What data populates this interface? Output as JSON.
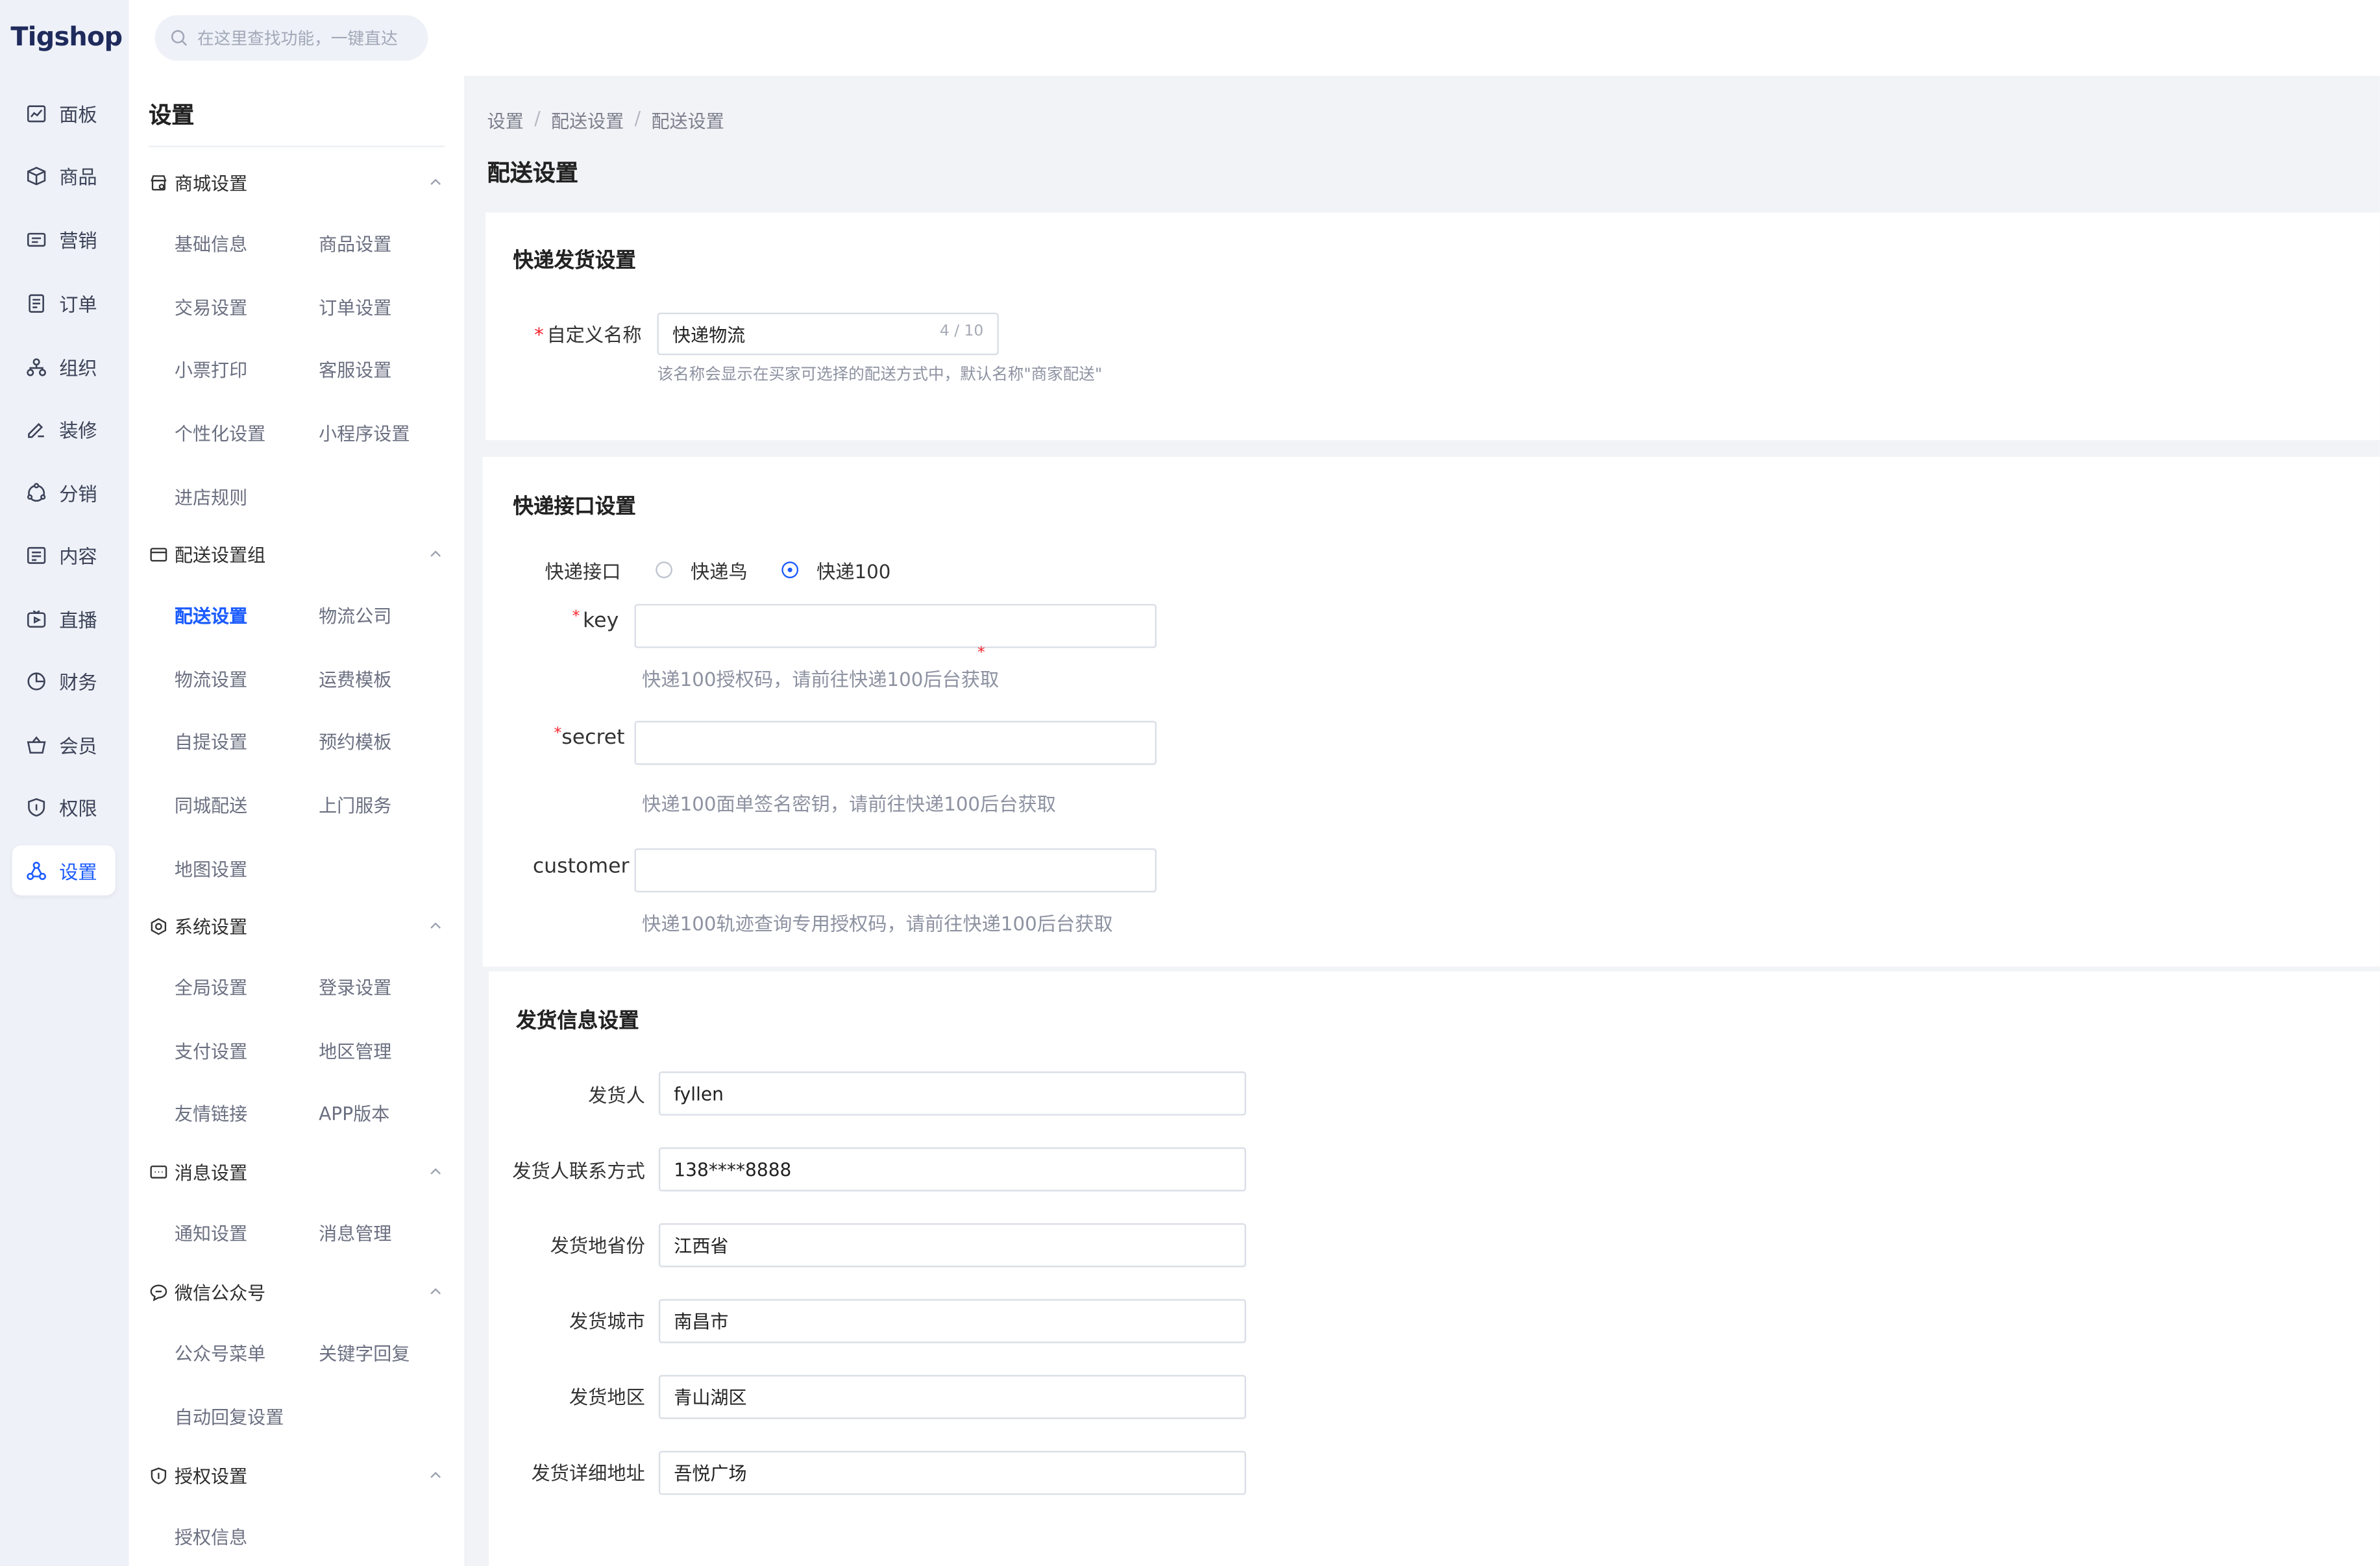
{
  "brand": {
    "logo": "Tigshop",
    "accent": "#1c5cff",
    "rail_bg": "#eef1f7"
  },
  "search": {
    "placeholder": "在这里查找功能，一键直达"
  },
  "rail": {
    "items": [
      {
        "label": "面板",
        "icon": "chart-icon"
      },
      {
        "label": "商品",
        "icon": "box-icon"
      },
      {
        "label": "营销",
        "icon": "ticket-icon"
      },
      {
        "label": "订单",
        "icon": "order-icon"
      },
      {
        "label": "组织",
        "icon": "org-icon"
      },
      {
        "label": "装修",
        "icon": "paint-icon"
      },
      {
        "label": "分销",
        "icon": "share-icon"
      },
      {
        "label": "内容",
        "icon": "content-icon"
      },
      {
        "label": "直播",
        "icon": "live-icon"
      },
      {
        "label": "财务",
        "icon": "pie-icon"
      },
      {
        "label": "会员",
        "icon": "basket-icon"
      },
      {
        "label": "权限",
        "icon": "shield-icon"
      },
      {
        "label": "设置",
        "icon": "settings-icon"
      }
    ]
  },
  "subnav": {
    "title": "设置",
    "groups": [
      {
        "label": "商城设置",
        "items": [
          "基础信息",
          "商品设置",
          "交易设置",
          "订单设置",
          "小票打印",
          "客服设置",
          "个性化设置",
          "小程序设置",
          "进店规则"
        ]
      },
      {
        "label": "配送设置组",
        "items": [
          "配送设置",
          "物流公司",
          "物流设置",
          "运费模板",
          "自提设置",
          "预约模板",
          "同城配送",
          "上门服务",
          "地图设置"
        ]
      },
      {
        "label": "系统设置",
        "items": [
          "全局设置",
          "登录设置",
          "支付设置",
          "地区管理",
          "友情链接",
          "APP版本"
        ]
      },
      {
        "label": "消息设置",
        "items": [
          "通知设置",
          "消息管理"
        ]
      },
      {
        "label": "微信公众号",
        "items": [
          "公众号菜单",
          "关键字回复",
          "自动回复设置"
        ]
      },
      {
        "label": "授权设置",
        "items": [
          "授权信息"
        ]
      }
    ]
  },
  "breadcrumb": [
    "设置",
    "配送设置",
    "配送设置"
  ],
  "page_title": "配送设置",
  "express_card": {
    "title": "快递发货设置",
    "name_label": "自定义名称",
    "name_value": "快递物流",
    "name_count": "4 / 10",
    "name_hint": "该名称会显示在买家可选择的配送方式中，默认名称\"商家配送\""
  },
  "api_card": {
    "title": "快递接口设置",
    "interface_label": "快递接口",
    "options": [
      "快递鸟",
      "快递100"
    ],
    "selected": "快递100",
    "key_label": "key",
    "key_hint": "快递100授权码，请前往快递100后台获取",
    "secret_label": "secret",
    "secret_hint": "快递100面单签名密钥，请前往快递100后台获取",
    "customer_label": "customer",
    "customer_hint": "快递100轨迹查询专用授权码，请前往快递100后台获取"
  },
  "ship_card": {
    "title": "发货信息设置",
    "fields": [
      {
        "label": "发货人",
        "value": "fyllen"
      },
      {
        "label": "发货人联系方式",
        "value": "138****8888"
      },
      {
        "label": "发货地省份",
        "value": "江西省"
      },
      {
        "label": "发货城市",
        "value": "南昌市"
      },
      {
        "label": "发货地区",
        "value": "青山湖区"
      },
      {
        "label": "发货详细地址",
        "value": "吾悦广场"
      }
    ]
  }
}
